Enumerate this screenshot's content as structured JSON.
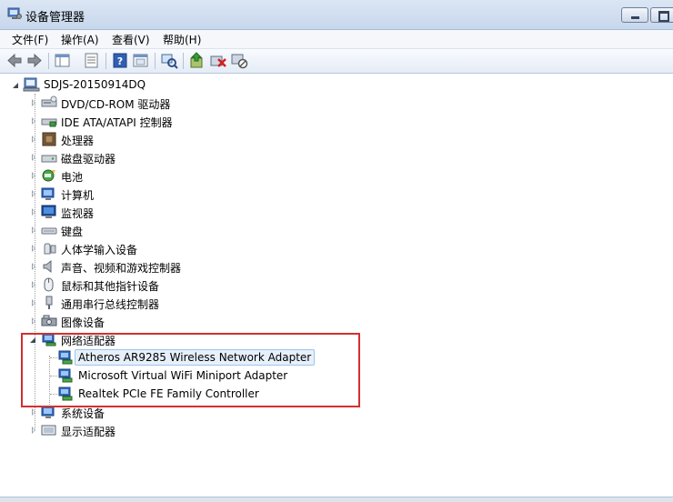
{
  "window": {
    "title": "设备管理器"
  },
  "menu": [
    {
      "label": "文件(F)"
    },
    {
      "label": "操作(A)"
    },
    {
      "label": "查看(V)"
    },
    {
      "label": "帮助(H)"
    }
  ],
  "toolbar_icons": [
    "back-arrow-icon",
    "forward-arrow-icon",
    "console-tree-icon",
    "properties-icon",
    "help-icon",
    "show-hide-pane-icon",
    "scan-hardware-icon",
    "update-driver-icon",
    "uninstall-icon",
    "disable-device-icon"
  ],
  "tree": {
    "root": "SDJS-20150914DQ",
    "categories": [
      {
        "label": "DVD/CD-ROM 驱动器",
        "icon": "dvd-drive-icon"
      },
      {
        "label": "IDE ATA/ATAPI 控制器",
        "icon": "ide-controller-icon"
      },
      {
        "label": "处理器",
        "icon": "processor-icon"
      },
      {
        "label": "磁盘驱动器",
        "icon": "disk-drive-icon"
      },
      {
        "label": "电池",
        "icon": "battery-icon"
      },
      {
        "label": "计算机",
        "icon": "computer-icon"
      },
      {
        "label": "监视器",
        "icon": "monitor-icon"
      },
      {
        "label": "键盘",
        "icon": "keyboard-icon"
      },
      {
        "label": "人体学输入设备",
        "icon": "hid-icon"
      },
      {
        "label": "声音、视频和游戏控制器",
        "icon": "sound-icon"
      },
      {
        "label": "鼠标和其他指针设备",
        "icon": "mouse-icon"
      },
      {
        "label": "通用串行总线控制器",
        "icon": "usb-icon"
      },
      {
        "label": "图像设备",
        "icon": "imaging-icon"
      }
    ],
    "network": {
      "label": "网络适配器",
      "children": [
        {
          "label": "Atheros AR9285 Wireless Network Adapter"
        },
        {
          "label": "Microsoft Virtual WiFi Miniport Adapter"
        },
        {
          "label": "Realtek PCIe FE Family Controller"
        }
      ]
    },
    "after": [
      {
        "label": "系统设备",
        "icon": "system-device-icon"
      },
      {
        "label": "显示适配器",
        "icon": "display-adapter-icon"
      }
    ]
  },
  "colors": {
    "highlight_border": "#d32f2f",
    "selection_bg": "#e6f0fb"
  }
}
